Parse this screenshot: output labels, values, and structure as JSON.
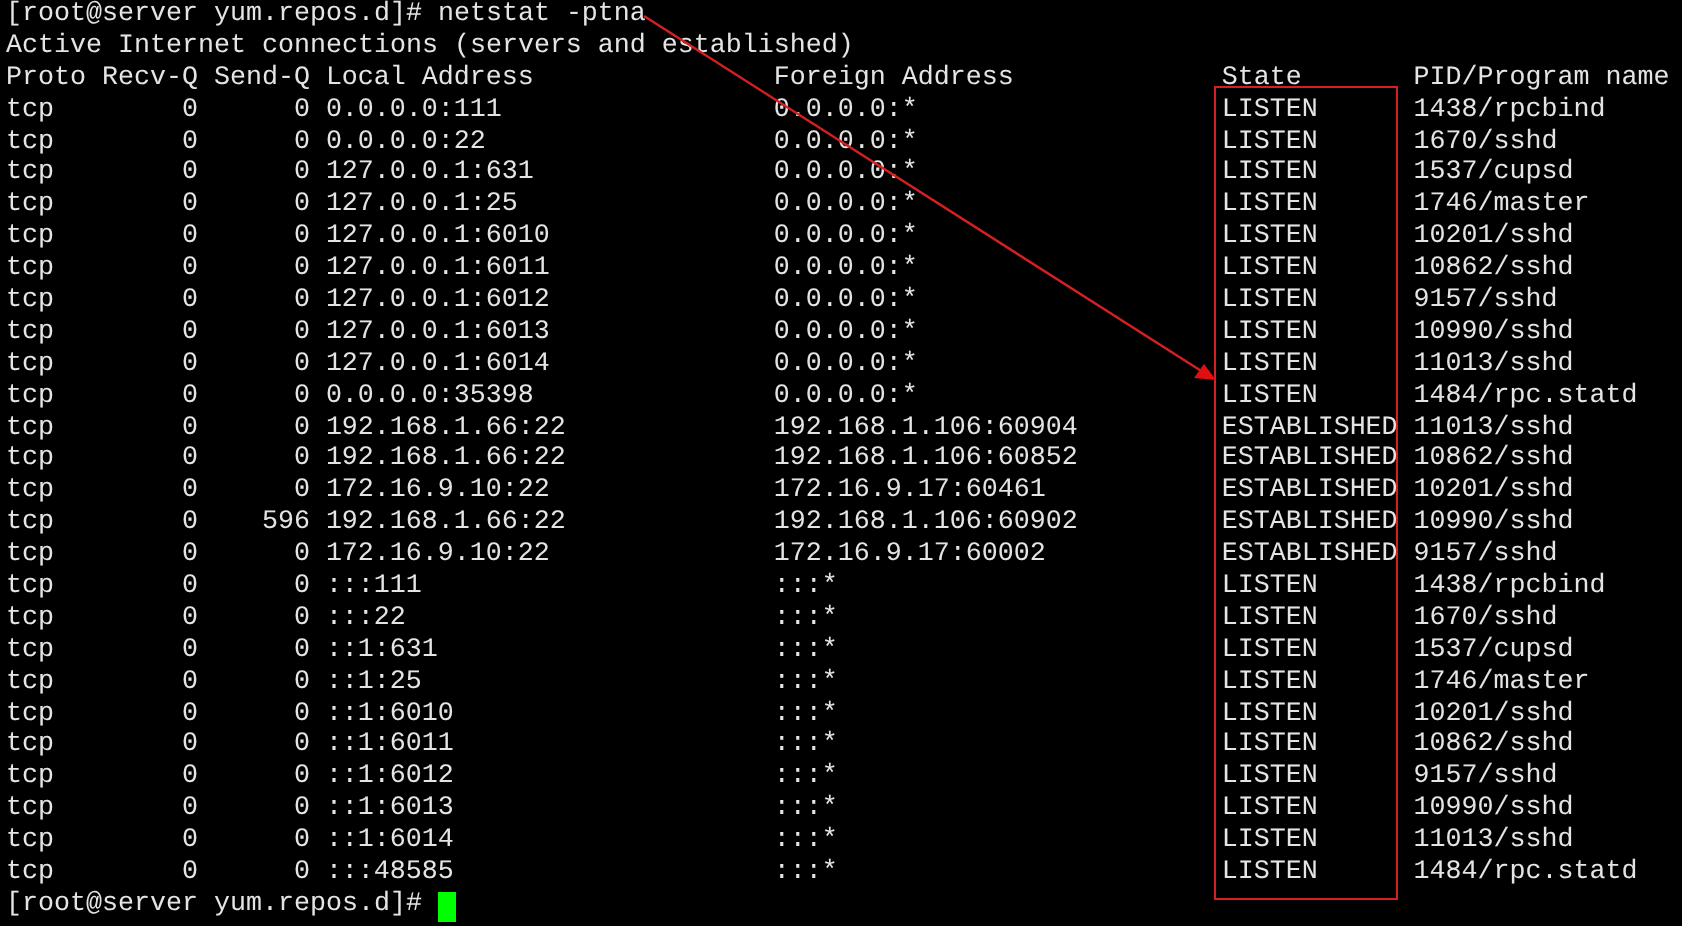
{
  "prompt_line": {
    "prompt": "[root@server yum.repos.d]#",
    "command": "netstat -ptna"
  },
  "banner": "Active Internet connections (servers and established)",
  "columns": [
    "Proto",
    "Recv-Q",
    "Send-Q",
    "Local Address",
    "Foreign Address",
    "State",
    "PID/Program name"
  ],
  "rows": [
    [
      "tcp",
      "0",
      "0",
      "0.0.0.0:111",
      "0.0.0.0:*",
      "LISTEN",
      "1438/rpcbind"
    ],
    [
      "tcp",
      "0",
      "0",
      "0.0.0.0:22",
      "0.0.0.0:*",
      "LISTEN",
      "1670/sshd"
    ],
    [
      "tcp",
      "0",
      "0",
      "127.0.0.1:631",
      "0.0.0.0:*",
      "LISTEN",
      "1537/cupsd"
    ],
    [
      "tcp",
      "0",
      "0",
      "127.0.0.1:25",
      "0.0.0.0:*",
      "LISTEN",
      "1746/master"
    ],
    [
      "tcp",
      "0",
      "0",
      "127.0.0.1:6010",
      "0.0.0.0:*",
      "LISTEN",
      "10201/sshd"
    ],
    [
      "tcp",
      "0",
      "0",
      "127.0.0.1:6011",
      "0.0.0.0:*",
      "LISTEN",
      "10862/sshd"
    ],
    [
      "tcp",
      "0",
      "0",
      "127.0.0.1:6012",
      "0.0.0.0:*",
      "LISTEN",
      "9157/sshd"
    ],
    [
      "tcp",
      "0",
      "0",
      "127.0.0.1:6013",
      "0.0.0.0:*",
      "LISTEN",
      "10990/sshd"
    ],
    [
      "tcp",
      "0",
      "0",
      "127.0.0.1:6014",
      "0.0.0.0:*",
      "LISTEN",
      "11013/sshd"
    ],
    [
      "tcp",
      "0",
      "0",
      "0.0.0.0:35398",
      "0.0.0.0:*",
      "LISTEN",
      "1484/rpc.statd"
    ],
    [
      "tcp",
      "0",
      "0",
      "192.168.1.66:22",
      "192.168.1.106:60904",
      "ESTABLISHED",
      "11013/sshd"
    ],
    [
      "tcp",
      "0",
      "0",
      "192.168.1.66:22",
      "192.168.1.106:60852",
      "ESTABLISHED",
      "10862/sshd"
    ],
    [
      "tcp",
      "0",
      "0",
      "172.16.9.10:22",
      "172.16.9.17:60461",
      "ESTABLISHED",
      "10201/sshd"
    ],
    [
      "tcp",
      "0",
      "596",
      "192.168.1.66:22",
      "192.168.1.106:60902",
      "ESTABLISHED",
      "10990/sshd"
    ],
    [
      "tcp",
      "0",
      "0",
      "172.16.9.10:22",
      "172.16.9.17:60002",
      "ESTABLISHED",
      "9157/sshd"
    ],
    [
      "tcp",
      "0",
      "0",
      ":::111",
      ":::*",
      "LISTEN",
      "1438/rpcbind"
    ],
    [
      "tcp",
      "0",
      "0",
      ":::22",
      ":::*",
      "LISTEN",
      "1670/sshd"
    ],
    [
      "tcp",
      "0",
      "0",
      "::1:631",
      ":::*",
      "LISTEN",
      "1537/cupsd"
    ],
    [
      "tcp",
      "0",
      "0",
      "::1:25",
      ":::*",
      "LISTEN",
      "1746/master"
    ],
    [
      "tcp",
      "0",
      "0",
      "::1:6010",
      ":::*",
      "LISTEN",
      "10201/sshd"
    ],
    [
      "tcp",
      "0",
      "0",
      "::1:6011",
      ":::*",
      "LISTEN",
      "10862/sshd"
    ],
    [
      "tcp",
      "0",
      "0",
      "::1:6012",
      ":::*",
      "LISTEN",
      "9157/sshd"
    ],
    [
      "tcp",
      "0",
      "0",
      "::1:6013",
      ":::*",
      "LISTEN",
      "10990/sshd"
    ],
    [
      "tcp",
      "0",
      "0",
      "::1:6014",
      ":::*",
      "LISTEN",
      "11013/sshd"
    ],
    [
      "tcp",
      "0",
      "0",
      ":::48585",
      ":::*",
      "LISTEN",
      "1484/rpc.statd"
    ]
  ],
  "final_prompt": "[root@server yum.repos.d]#"
}
